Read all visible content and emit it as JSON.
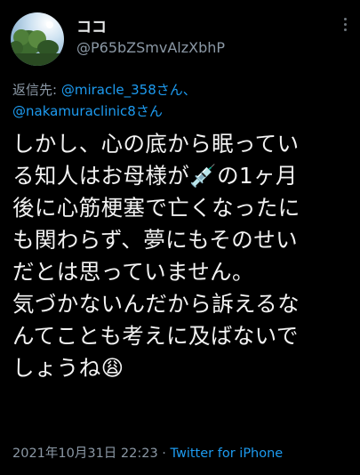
{
  "user": {
    "display_name": "ココ",
    "handle": "@P65bZSmvAlzXbhP"
  },
  "reply": {
    "prefix": "返信先: ",
    "mention1": "@miracle_358さん、",
    "mention2": "@nakamuraclinic8さん"
  },
  "tweet": {
    "lines": [
      "しかし、心の底から眠ってい",
      "る知人はお母様が💉の1ヶ月",
      "後に心筋梗塞で亡くなったに",
      "も関わらず、夢にもそのせい",
      "だとは思っていません。",
      "気づかないんだから訴えるな",
      "んてことも考えに及ばないで",
      "しょうね😩"
    ]
  },
  "meta": {
    "timestamp": "2021年10月31日 22:23 · ",
    "source": "Twitter for iPhone"
  },
  "colors": {
    "background": "#000000",
    "accent": "#1d9bf0",
    "secondary_text": "#8b98a5"
  },
  "icons": {
    "more": "more-vertical-icon"
  }
}
